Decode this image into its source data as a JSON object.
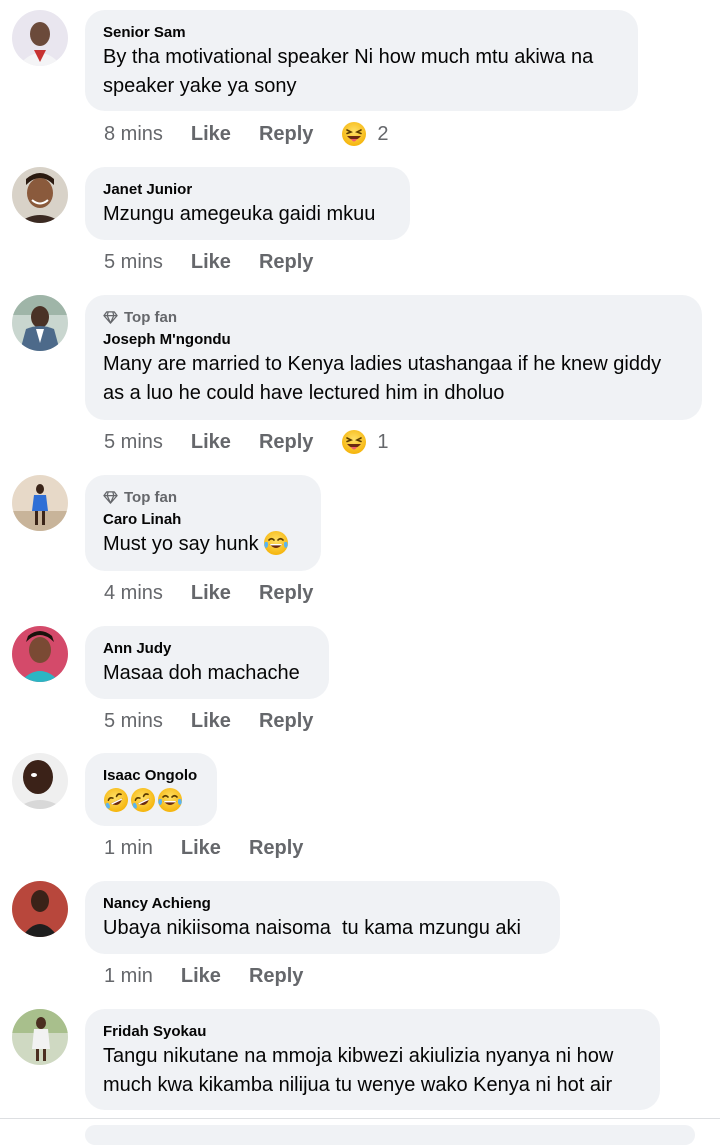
{
  "colors": {
    "bubble": "#f0f2f5",
    "meta": "#65676b",
    "text": "#050505"
  },
  "comments": [
    {
      "author": "Senior Sam",
      "text": "By tha motivational speaker Ni how much mtu akiwa na speaker yake ya sony",
      "time": "8 mins",
      "like": "Like",
      "reply": "Reply",
      "reaction_icon": "grinning-squint-tongue-emoji",
      "reaction_count": "2"
    },
    {
      "author": "Janet Junior",
      "text": "Mzungu amegeuka gaidi mkuu",
      "time": "5 mins",
      "like": "Like",
      "reply": "Reply"
    },
    {
      "badge": "Top fan",
      "author": "Joseph M'ngondu",
      "text": "Many are married to Kenya ladies utashangaa if he knew giddy as a luo he could have lectured him in dholuo",
      "time": "5 mins",
      "like": "Like",
      "reply": "Reply",
      "reaction_icon": "grinning-squint-tongue-emoji",
      "reaction_count": "1"
    },
    {
      "badge": "Top fan",
      "author": "Caro Linah",
      "text": "Must yo say hunk",
      "text_emoji": "tears-of-joy-emoji",
      "time": "4 mins",
      "like": "Like",
      "reply": "Reply"
    },
    {
      "author": "Ann Judy",
      "text": "Masaa doh machache",
      "time": "5 mins",
      "like": "Like",
      "reply": "Reply"
    },
    {
      "author": "Isaac Ongolo",
      "emojis": [
        "rolling-on-floor-laughing-emoji",
        "rolling-on-floor-laughing-emoji",
        "tears-of-joy-emoji"
      ],
      "time": "1 min",
      "like": "Like",
      "reply": "Reply"
    },
    {
      "author": "Nancy Achieng",
      "text": "Ubaya nikiisoma naisoma  tu kama mzungu aki",
      "time": "1 min",
      "like": "Like",
      "reply": "Reply"
    },
    {
      "author": "Fridah Syokau",
      "text": "Tangu nikutane na mmoja kibwezi akiulizia nyanya ni how much kwa kikamba nilijua tu wenye wako Kenya ni hot air"
    }
  ]
}
